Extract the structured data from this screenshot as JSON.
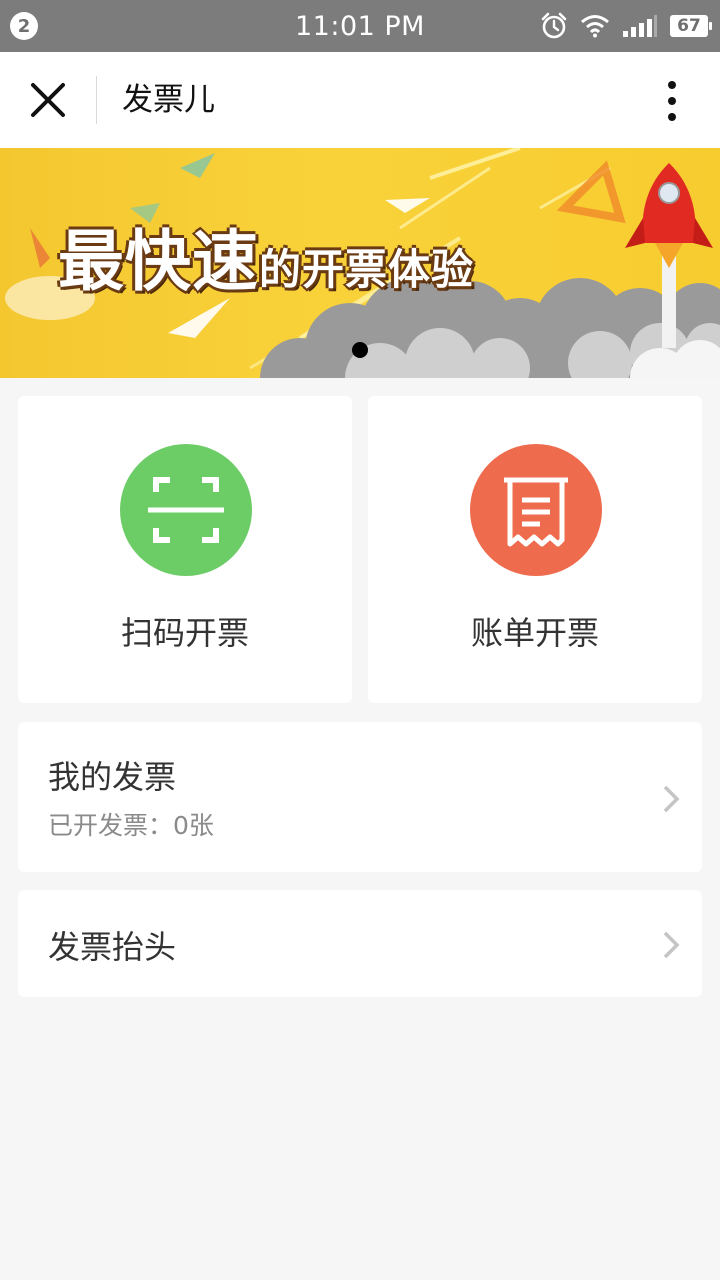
{
  "status_bar": {
    "notification_count": "2",
    "time": "11:01 PM",
    "battery": "67",
    "icons": [
      "alarm-icon",
      "wifi-icon",
      "signal-icon",
      "battery-icon"
    ]
  },
  "nav": {
    "title": "发票儿",
    "close_icon": "close-icon",
    "more_icon": "more-vertical-icon"
  },
  "banner": {
    "headline_big_1": "最",
    "headline_big_2": "快",
    "headline_big_3": "速",
    "headline_small": "的开票体验",
    "page_indicator_count": 1
  },
  "tiles": [
    {
      "label": "扫码开票",
      "icon": "scan-qr-icon",
      "color": "#6ccc66"
    },
    {
      "label": "账单开票",
      "icon": "receipt-icon",
      "color": "#ef6b4d"
    }
  ],
  "my_invoices": {
    "title": "我的发票",
    "subtitle": "已开发票：0张"
  },
  "invoice_header": {
    "title": "发票抬头"
  },
  "colors": {
    "background": "#f6f6f6",
    "status_bar": "#7c7c7c",
    "banner_yellow": "#f9d23a"
  }
}
